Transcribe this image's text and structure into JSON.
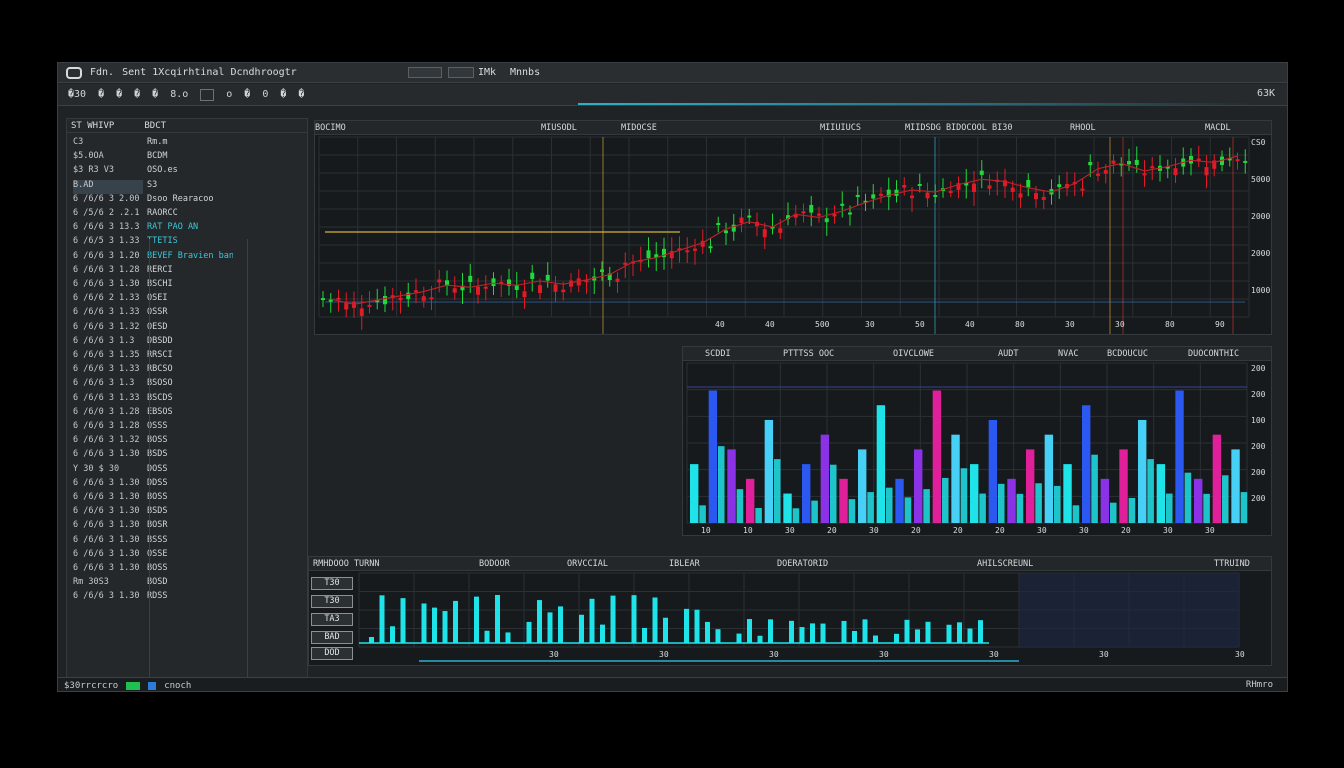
{
  "window": {
    "title": "Sent 1Xcqirhtinal Dcndhroogtr",
    "title_short": "Fdn.",
    "segment_label": "IMk",
    "segment_label2": "Mnnbs",
    "toolbar_items": [
      "�30",
      "�",
      "�",
      "�",
      "�",
      "8.o",
      "o",
      "�",
      "0",
      "�",
      "�"
    ],
    "toolbar_right": "63K"
  },
  "left_panel": {
    "headers": [
      "ST WHIVP",
      "BDCT"
    ],
    "top_rows": [
      {
        "a": "C3",
        "b": "Rm.m"
      },
      {
        "a": "$5.0OA",
        "b": "BCDM"
      },
      {
        "a": "$3 R3 V3",
        "b": "OSO.es"
      },
      {
        "a": "B.AD",
        "b": "S3"
      }
    ],
    "rows": [
      {
        "a": "6 /6/6 3 2.00",
        "b": "Dsoo Rearacoo",
        "cy": false
      },
      {
        "a": "6 /5/6 2 .2.1",
        "b": "RAORCC",
        "cy": false
      },
      {
        "a": "6 /6/6 3 13.3",
        "b": "RAT PAO AN",
        "cy": true
      },
      {
        "a": "6 /6/5 3 1.33",
        "b": "TTETIS",
        "cy": true
      },
      {
        "a": "6 /6/6 3 1.20",
        "b": "BEVEF Bravien ban",
        "cy": true
      },
      {
        "a": "6 /6/6 3 1.28",
        "b": "RERCI",
        "cy": false
      },
      {
        "a": "6 /6/6 3 1.30",
        "b": "BSCHI",
        "cy": false
      },
      {
        "a": "6 /6/6 2 1.33",
        "b": "OSEI",
        "cy": false
      },
      {
        "a": "6 /6/6 3 1.33",
        "b": "OSSR",
        "cy": false
      },
      {
        "a": "6 /6/6 3 1.32",
        "b": "OESD",
        "cy": false
      },
      {
        "a": "6 /6/6 3 1.3",
        "b": "DBSDD",
        "cy": false
      },
      {
        "a": "6 /6/6 3 1.35",
        "b": "RRSCI",
        "cy": false
      },
      {
        "a": "6 /6/6 3 1.33",
        "b": "RBCSO",
        "cy": false
      },
      {
        "a": "6 /6/6 3 1.3",
        "b": "BSOSO",
        "cy": false
      },
      {
        "a": "6 /6/6 3 1.33",
        "b": "BSCDS",
        "cy": false
      },
      {
        "a": "6 /6/0 3 1.28",
        "b": "EBSOS",
        "cy": false
      },
      {
        "a": "6 /6/6 3 1.28",
        "b": "OSSS",
        "cy": false
      },
      {
        "a": "6 /6/6 3 1.32",
        "b": "BOSS",
        "cy": false
      },
      {
        "a": "6 /6/6 3 1.30",
        "b": "BSDS",
        "cy": false
      },
      {
        "a": "Y 30 $ 30",
        "b": "DOSS",
        "cy": false
      },
      {
        "a": "6 /6/6 3 1.30",
        "b": "DDSS",
        "cy": false
      },
      {
        "a": "6 /6/6 3 1.30",
        "b": "BOSS",
        "cy": false
      },
      {
        "a": "6 /6/6 3 1.30",
        "b": "BSDS",
        "cy": false
      },
      {
        "a": "6 /6/6 3 1.30",
        "b": "BOSR",
        "cy": false
      },
      {
        "a": "6 /6/6 3 1.30",
        "b": "BSSS",
        "cy": false
      },
      {
        "a": "6 /6/6 3 1.30",
        "b": "OSSE",
        "cy": false
      },
      {
        "a": "6 /6/6 3 1.30",
        "b": "BOSS",
        "cy": false
      },
      {
        "a": "Rm 30S3",
        "b": "BOSD",
        "cy": false
      },
      {
        "a": "6 /6/6 3 1.30",
        "b": "RDSS",
        "cy": false
      }
    ]
  },
  "price_panel": {
    "headers": [
      "BOCIMO",
      "MIUSODL",
      "MIDOCSE",
      "MIIUIUCS",
      "MIIDSDG BIDOCOOL BI30",
      "RHOOL",
      "MACDL"
    ],
    "right_ticks": [
      "CS0",
      "5000",
      "2000",
      "2000",
      "1000"
    ],
    "bottom_ticks": [
      "40",
      "40",
      "500",
      "30",
      "50",
      "40",
      "80",
      "30",
      "30",
      "80",
      "90"
    ]
  },
  "volume_panel": {
    "headers": [
      "SCDDI",
      "PTTTSS OOC",
      "OIVCLOWE",
      "AUDT",
      "NVAC",
      "BCDOUCUC",
      "DUOCONTHIC"
    ],
    "right_ticks": [
      "200",
      "200",
      "100",
      "200",
      "200",
      "200"
    ],
    "bottom_ticks": [
      "10",
      "10",
      "30",
      "20",
      "30",
      "20",
      "20",
      "20",
      "30",
      "30",
      "20",
      "30",
      "30"
    ]
  },
  "lower_panel": {
    "headers": [
      "RMHDOOO TURNN",
      "BODOOR",
      "ORVCCIAL",
      "IBLEAR",
      "DOERATORID",
      "AHILSCREUNL",
      "TTRUIND"
    ],
    "labels": [
      "T30",
      "T30",
      "TA3",
      "BAD",
      "DOD"
    ],
    "bottom_ticks": [
      "30",
      "30",
      "30",
      "30",
      "30",
      "30"
    ],
    "corner_tick": "30"
  },
  "status": {
    "left": "$30rrcrcro",
    "mid": "cnoch",
    "right": "RHmro"
  },
  "colors": {
    "bull": "#1fd93a",
    "bear": "#e21a26",
    "cyan": "#1ee3e8",
    "blue": "#2a58f0",
    "purple": "#8b32e6",
    "magenta": "#e0209a",
    "grid": "#2a3034"
  },
  "chart_data": [
    {
      "type": "line",
      "title": "",
      "series": [
        {
          "name": "",
          "values": [
            470,
            420,
            460,
            500,
            540,
            600,
            580,
            620,
            600,
            640,
            610,
            650,
            700,
            820,
            860,
            930,
            1000,
            1130,
            1200,
            1150,
            1270,
            1240,
            1300,
            1380,
            1450,
            1500,
            1480,
            1550,
            1600,
            1580,
            1520,
            1480,
            1560,
            1700,
            1750,
            1680,
            1720,
            1780,
            1760,
            1820
          ]
        }
      ]
    },
    {
      "type": "bar",
      "title": "",
      "series": [
        {
          "name": "",
          "values": [
            0.4,
            0.9,
            0.5,
            0.3,
            0.7,
            0.2,
            0.4,
            0.6,
            0.3,
            0.5,
            0.8,
            0.3,
            0.5,
            0.9,
            0.6,
            0.4,
            0.7,
            0.3,
            0.5,
            0.6,
            0.4,
            0.8,
            0.3,
            0.5,
            0.7,
            0.4,
            0.9,
            0.3,
            0.6,
            0.5
          ]
        }
      ]
    }
  ]
}
